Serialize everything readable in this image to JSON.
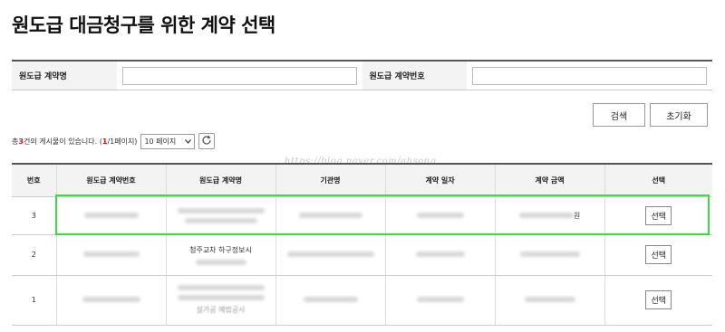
{
  "page": {
    "title": "원도급 대금청구를 위한 계약 선택"
  },
  "search": {
    "contract_name_label": "원도급 계약명",
    "contract_name_value": "",
    "contract_number_label": "원도급 계약번호",
    "contract_number_value": "",
    "search_button": "검색",
    "reset_button": "초기화"
  },
  "summary": {
    "prefix": "총 ",
    "count": "3",
    "suffix": "건의 게시물이 있습니다. (",
    "page_current": "1",
    "page_rest": " /1페이지)",
    "page_size": "10 페이지"
  },
  "watermark": "https://blog.naver.com/ahsong",
  "table": {
    "headers": [
      "번호",
      "원도급 계약번호",
      "원도급 계약명",
      "기관명",
      "계약 일자",
      "계약 금액",
      "선택"
    ],
    "rows": [
      {
        "no": "3",
        "amount_suffix": "원",
        "select_label": "선택"
      },
      {
        "no": "2",
        "name_line1": "청주교차 하구정보시",
        "select_label": "선택"
      },
      {
        "no": "1",
        "name_line3": "설가공 예법공사",
        "select_label": "선택"
      }
    ]
  },
  "colors": {
    "highlight": "#3ddc3d",
    "count_accent": "#dd1111",
    "header_bg": "#f3f3f3"
  }
}
